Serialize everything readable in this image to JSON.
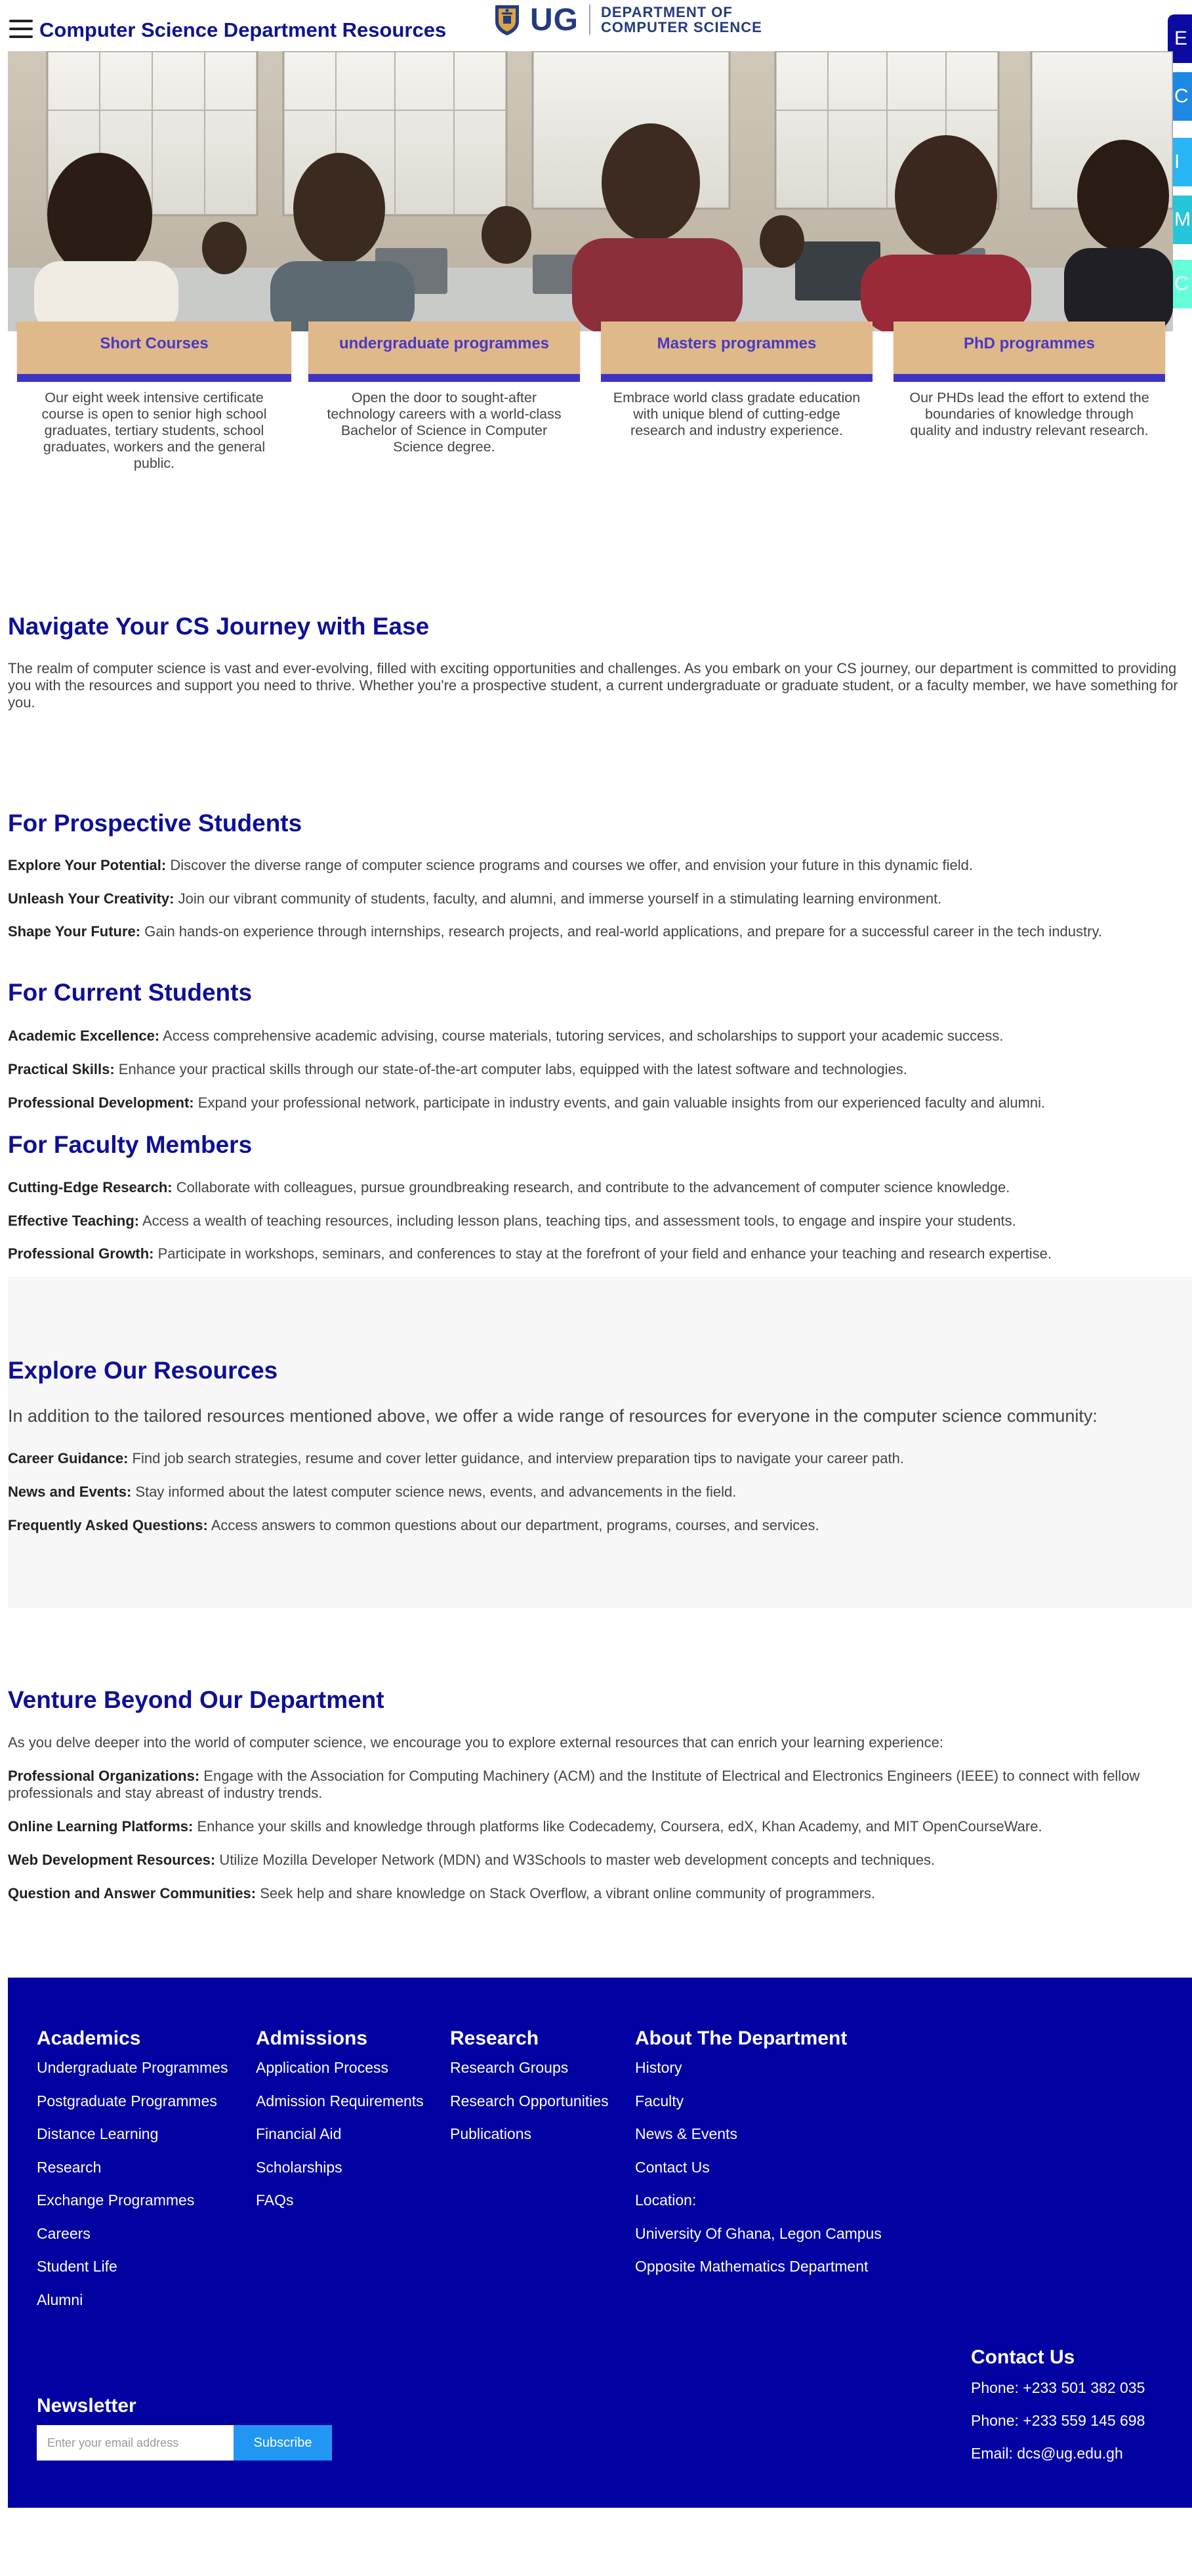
{
  "header": {
    "title": "Computer Science Department Resources",
    "logo_text": "UG",
    "logo_dept_line1": "DEPARTMENT OF",
    "logo_dept_line2": "COMPUTER SCIENCE"
  },
  "side_tabs": [
    {
      "label": "E",
      "color": "#0b0ba3"
    },
    {
      "label": "C",
      "color": "#1e88e5"
    },
    {
      "label": "I",
      "color": "#29b6f6"
    },
    {
      "label": "M",
      "color": "#26c6da"
    },
    {
      "label": "C",
      "color": "#64ffda"
    }
  ],
  "programs": [
    {
      "title": "Short Courses",
      "description": "Our eight week intensive certificate course is open to senior high school graduates, tertiary students, school graduates, workers and the general public."
    },
    {
      "title": "undergraduate programmes",
      "description": "Open the door to sought-after technology careers with a world-class Bachelor of Science in Computer Science degree."
    },
    {
      "title": "Masters programmes",
      "description": "Embrace world class gradate education with unique blend of cutting-edge research and industry experience."
    },
    {
      "title": "PhD programmes",
      "description": "Our PHDs lead the effort to extend the boundaries of knowledge through quality and industry relevant research."
    }
  ],
  "intro": {
    "heading": "Navigate Your CS Journey with Ease",
    "text": "The realm of computer science is vast and ever-evolving, filled with exciting opportunities and challenges. As you embark on your CS journey, our department is committed to providing you with the resources and support you need to thrive. Whether you're a prospective student, a current undergraduate or graduate student, or a faculty member, we have something for you."
  },
  "prospective": {
    "heading": "For Prospective Students",
    "items": [
      {
        "label": "Explore Your Potential:",
        "text": "Discover the diverse range of computer science programs and courses we offer, and envision your future in this dynamic field."
      },
      {
        "label": "Unleash Your Creativity:",
        "text": "Join our vibrant community of students, faculty, and alumni, and immerse yourself in a stimulating learning environment."
      },
      {
        "label": "Shape Your Future:",
        "text": "Gain hands-on experience through internships, research projects, and real-world applications, and prepare for a successful career in the tech industry."
      }
    ]
  },
  "current": {
    "heading": "For Current Students",
    "items": [
      {
        "label": "Academic Excellence:",
        "text": "Access comprehensive academic advising, course materials, tutoring services, and scholarships to support your academic success."
      },
      {
        "label": "Practical Skills:",
        "text": "Enhance your practical skills through our state-of-the-art computer labs, equipped with the latest software and technologies."
      },
      {
        "label": "Professional Development:",
        "text": "Expand your professional network, participate in industry events, and gain valuable insights from our experienced faculty and alumni."
      }
    ]
  },
  "faculty": {
    "heading": "For Faculty Members",
    "items": [
      {
        "label": "Cutting-Edge Research:",
        "text": "Collaborate with colleagues, pursue groundbreaking research, and contribute to the advancement of computer science knowledge."
      },
      {
        "label": "Effective Teaching:",
        "text": "Access a wealth of teaching resources, including lesson plans, teaching tips, and assessment tools, to engage and inspire your students."
      },
      {
        "label": "Professional Growth:",
        "text": "Participate in workshops, seminars, and conferences to stay at the forefront of your field and enhance your teaching and research expertise."
      }
    ]
  },
  "resources": {
    "heading": "Explore Our Resources",
    "lead": "In addition to the tailored resources mentioned above, we offer a wide range of resources for everyone in the computer science community:",
    "items": [
      {
        "label": "Career Guidance:",
        "text": "Find job search strategies, resume and cover letter guidance, and interview preparation tips to navigate your career path."
      },
      {
        "label": "News and Events:",
        "text": "Stay informed about the latest computer science news, events, and advancements in the field."
      },
      {
        "label": "Frequently Asked Questions:",
        "text": "Access answers to common questions about our department, programs, courses, and services."
      }
    ]
  },
  "beyond": {
    "heading": "Venture Beyond Our Department",
    "lead": "As you delve deeper into the world of computer science, we encourage you to explore external resources that can enrich your learning experience:",
    "items": [
      {
        "label": "Professional Organizations:",
        "text": "Engage with the Association for Computing Machinery (ACM) and the Institute of Electrical and Electronics Engineers (IEEE) to connect with fellow professionals and stay abreast of industry trends."
      },
      {
        "label": "Online Learning Platforms:",
        "text": "Enhance your skills and knowledge through platforms like Codecademy, Coursera, edX, Khan Academy, and MIT OpenCourseWare."
      },
      {
        "label": "Web Development Resources:",
        "text": "Utilize Mozilla Developer Network (MDN) and W3Schools to master web development concepts and techniques."
      },
      {
        "label": "Question and Answer Communities:",
        "text": "Seek help and share knowledge on Stack Overflow, a vibrant online community of programmers."
      }
    ]
  },
  "footer": {
    "academics": {
      "heading": "Academics",
      "links": [
        "Undergraduate Programmes",
        "Postgraduate Programmes",
        "Distance Learning",
        "Research",
        "Exchange Programmes",
        "Careers",
        "Student Life",
        "Alumni"
      ]
    },
    "admissions": {
      "heading": "Admissions",
      "links": [
        "Application Process",
        "Admission Requirements",
        "Financial Aid",
        "Scholarships",
        "FAQs"
      ]
    },
    "research": {
      "heading": "Research",
      "links": [
        "Research Groups",
        "Research Opportunities",
        "Publications"
      ]
    },
    "about": {
      "heading": "About The Department",
      "links": [
        "History",
        "Faculty",
        "News & Events",
        "Contact Us"
      ],
      "location_label": "Location:",
      "location_lines": [
        "University Of Ghana, Legon Campus",
        "Opposite Mathematics Department"
      ]
    },
    "contact": {
      "heading": "Contact Us",
      "lines": [
        "Phone: +233 501 382 035",
        "Phone: +233 559 145 698",
        "Email: dcs@ug.edu.gh"
      ]
    },
    "newsletter": {
      "heading": "Newsletter",
      "placeholder": "Enter your email address",
      "button": "Subscribe"
    }
  }
}
